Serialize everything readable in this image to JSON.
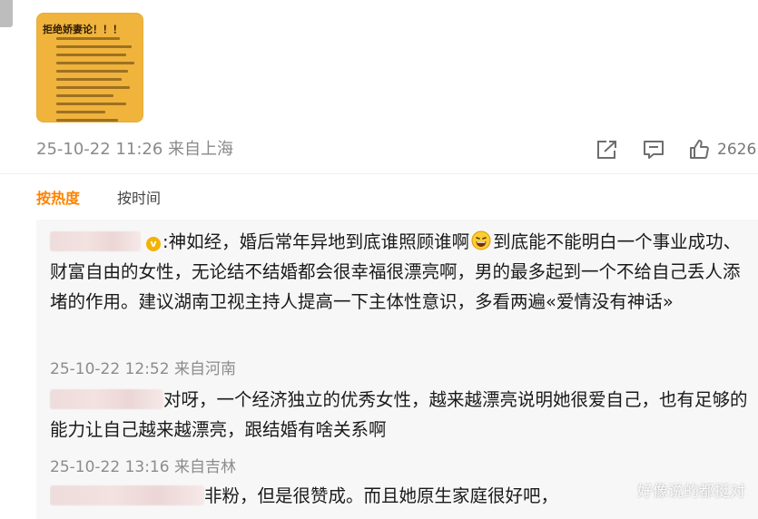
{
  "post": {
    "image_title": "拒绝娇妻论！！！",
    "timestamp": "25-10-22 11:26",
    "location": "来自上海",
    "like_count": "2626"
  },
  "sort_tabs": {
    "hot": "按热度",
    "time": "按时间"
  },
  "comments": [
    {
      "text": ":神如经，婚后常年异地到底谁照顾谁啊",
      "text_after_emoji": "到底能不能明白一个事业成功、财富自由的女性，无论结不结婚都会很幸福很漂亮啊，男的最多起到一个不给自己丢人添堵的作用。建议湖南卫视主持人提高一下主体性意识，多看两遍«爱情没有神话»",
      "timestamp": "25-10-22 12:52",
      "location": "来自河南"
    },
    {
      "text": "对呀，一个经济独立的优秀女性，越来越漂亮说明她很爱自己，也有足够的能力让自己越来越漂亮，跟结婚有啥关系啊",
      "timestamp": "25-10-22 13:16",
      "location": "来自吉林"
    },
    {
      "text": "非粉，但是很赞成。而且她原生家庭很好吧，"
    }
  ],
  "watermark": "好像说的都挺对"
}
